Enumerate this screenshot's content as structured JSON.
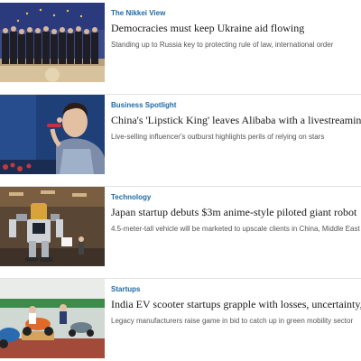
{
  "articles": [
    {
      "tag": "The Nikkei View",
      "headline": "Democracies must keep Ukraine aid flowing",
      "summary": "Standing up to Russia key to protecting rule of law, international order"
    },
    {
      "tag": "Business Spotlight",
      "headline": "China's 'Lipstick King' leaves Alibaba with a livestreaming dilemma",
      "summary": "Live-selling influencer's outburst highlights perils of relying on stars"
    },
    {
      "tag": "Technology",
      "headline": "Japan startup debuts $3m anime-style piloted giant robot",
      "summary": "4.5-meter-tall vehicle will be marketed to upscale clients in China, Middle East"
    },
    {
      "tag": "Startups",
      "headline": "India EV scooter startups grapple with losses, uncertainty, rivals",
      "summary": "Legacy manufacturers raise game in bid to catch up in green mobility sector"
    }
  ],
  "colors": {
    "tag": "#1d6aa6",
    "headline": "#1a1a1a",
    "summary": "#555555",
    "divider": "#e2e2e2"
  }
}
